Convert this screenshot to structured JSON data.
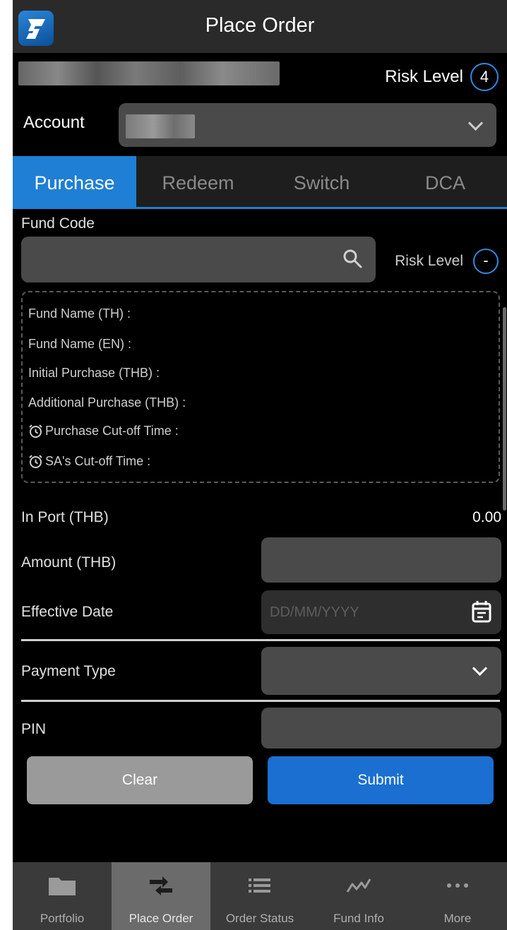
{
  "header": {
    "title": "Place Order"
  },
  "account": {
    "risk_level_label": "Risk Level",
    "risk_level_value": "4",
    "account_label": "Account"
  },
  "tabs": [
    {
      "label": "Purchase",
      "active": true
    },
    {
      "label": "Redeem",
      "active": false
    },
    {
      "label": "Switch",
      "active": false
    },
    {
      "label": "DCA",
      "active": false
    }
  ],
  "form": {
    "fund_code_label": "Fund Code",
    "fund_code_value": "",
    "risk_level_label": "Risk Level",
    "risk_level_value": "-",
    "info": {
      "fund_name_th": "Fund Name (TH) :",
      "fund_name_en": "Fund Name (EN) :",
      "initial_purchase": "Initial Purchase (THB) :",
      "additional_purchase": "Additional Purchase (THB) :",
      "purchase_cutoff": "Purchase Cut-off Time :",
      "sa_cutoff": "SA's Cut-off Time :"
    },
    "in_port_label": "In Port (THB)",
    "in_port_value": "0.00",
    "amount_label": "Amount (THB)",
    "amount_value": "",
    "effective_date_label": "Effective Date",
    "effective_date_placeholder": "DD/MM/YYYY",
    "payment_type_label": "Payment Type",
    "payment_type_value": "",
    "pin_label": "PIN",
    "pin_value": ""
  },
  "buttons": {
    "clear": "Clear",
    "submit": "Submit"
  },
  "bottom_nav": [
    {
      "label": "Portfolio",
      "icon": "folder-icon",
      "active": false
    },
    {
      "label": "Place Order",
      "icon": "transfer-arrows-icon",
      "active": true
    },
    {
      "label": "Order Status",
      "icon": "list-icon",
      "active": false
    },
    {
      "label": "Fund Info",
      "icon": "trend-line-icon",
      "active": false
    },
    {
      "label": "More",
      "icon": "more-dots-icon",
      "active": false
    }
  ],
  "colors": {
    "accent": "#1e7fd4",
    "submit": "#1a6fd0",
    "background": "#000000",
    "input": "#4a4a4a"
  }
}
